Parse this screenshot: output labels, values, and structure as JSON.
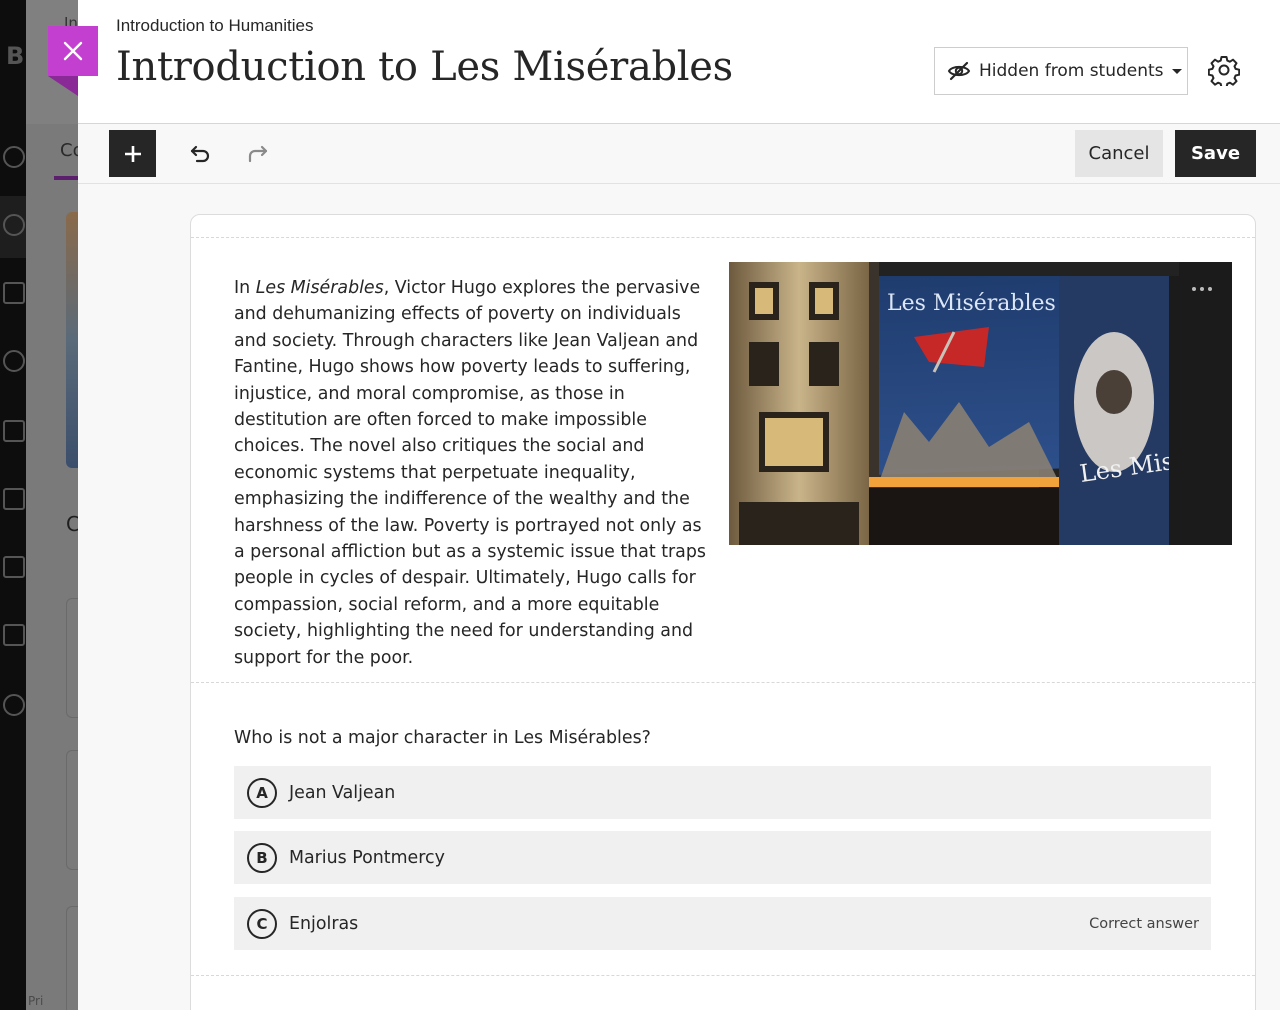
{
  "header": {
    "breadcrumb": "Introduction to Humanities",
    "title": "Introduction to Les Misérables",
    "visibility_label": "Hidden from students",
    "settings_icon": "gear-icon"
  },
  "toolbar": {
    "add_icon": "plus-icon",
    "undo_icon": "undo-icon",
    "redo_icon": "redo-icon",
    "cancel_label": "Cancel",
    "save_label": "Save"
  },
  "content": {
    "intro_lead": "In ",
    "intro_italic": "Les Misérables",
    "intro_rest": ", Victor Hugo explores the pervasive and dehumanizing effects of poverty on individuals and society. Through characters like Jean Valjean and Fantine, Hugo shows how poverty leads to suffering, injustice, and moral compromise, as those in destitution are often forced to make impossible choices. The novel also critiques the social and economic systems that perpetuate inequality, emphasizing the indifference of the wealthy and the harshness of the law. Poverty is portrayed not only as a personal affliction but as a systemic issue that traps people in cycles of despair. Ultimately, Hugo calls for compassion, social reform, and a more equitable society, highlighting the need for understanding and support for the poor.",
    "image_signs": [
      "Les Misérables",
      "Les Mis"
    ]
  },
  "question": {
    "prompt": "Who is not a major character in Les Misérables?",
    "options": [
      {
        "letter": "A",
        "text": "Jean Valjean",
        "note": ""
      },
      {
        "letter": "B",
        "text": "Marius Pontmercy",
        "note": ""
      },
      {
        "letter": "C",
        "text": "Enjolras",
        "note": "Correct answer"
      }
    ]
  },
  "background": {
    "logo": "B",
    "tab_fragment": "Co",
    "heading_fragment": "C",
    "footer_fragment": "Pri",
    "breadcrumb_fragment": "In"
  },
  "colors": {
    "accent": "#c23fcf",
    "dark": "#262626",
    "tab_underline": "#5b1f6e"
  }
}
